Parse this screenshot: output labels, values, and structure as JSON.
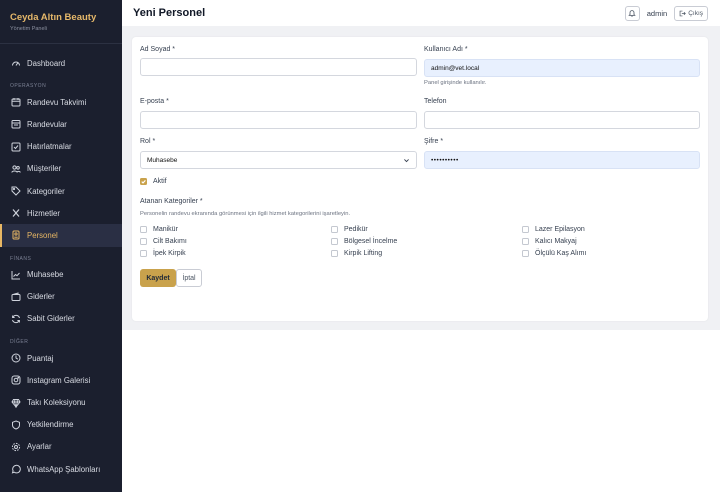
{
  "brand": {
    "title": "Ceyda Altın Beauty",
    "subtitle": "Yönetim Paneli"
  },
  "sidebar": {
    "sections": {
      "operasyon": "OPERASYON",
      "finans": "FİNANS",
      "diger": "DİĞER"
    },
    "items": [
      {
        "label": "Dashboard",
        "icon": "gauge-icon"
      },
      {
        "label": "Randevu Takvimi",
        "icon": "calendar-icon"
      },
      {
        "label": "Randevular",
        "icon": "calendar-list-icon"
      },
      {
        "label": "Hatırlatmalar",
        "icon": "checklist-icon"
      },
      {
        "label": "Müşteriler",
        "icon": "users-icon"
      },
      {
        "label": "Kategoriler",
        "icon": "tag-icon"
      },
      {
        "label": "Hizmetler",
        "icon": "scissors-icon"
      },
      {
        "label": "Personel",
        "icon": "id-card-icon",
        "active": true
      },
      {
        "label": "Muhasebe",
        "icon": "chart-line-icon"
      },
      {
        "label": "Giderler",
        "icon": "wallet-icon"
      },
      {
        "label": "Sabit Giderler",
        "icon": "repeat-icon"
      },
      {
        "label": "Puantaj",
        "icon": "clock-icon"
      },
      {
        "label": "Instagram Galerisi",
        "icon": "instagram-icon"
      },
      {
        "label": "Takı Koleksiyonu",
        "icon": "gem-icon"
      },
      {
        "label": "Yetkilendirme",
        "icon": "shield-icon"
      },
      {
        "label": "Ayarlar",
        "icon": "gear-icon"
      },
      {
        "label": "WhatsApp Şablonları",
        "icon": "whatsapp-icon"
      }
    ]
  },
  "header": {
    "title": "Yeni Personel",
    "user": "admin",
    "logout": "Çıkış"
  },
  "form": {
    "name_label": "Ad Soyad *",
    "name_value": "",
    "username_label": "Kullanıcı Adı *",
    "username_value": "admin@vet.local",
    "username_hint": "Panel girişinde kullanılır.",
    "email_label": "E-posta *",
    "email_value": "",
    "phone_label": "Telefon",
    "phone_value": "",
    "role_label": "Rol *",
    "role_value": "Muhasebe",
    "password_label": "Şifre *",
    "password_value": "••••••••••",
    "active_label": "Aktif",
    "active_checked": true,
    "categories_label": "Atanan Kategoriler *",
    "categories_hint": "Personelin randevu ekranında görünmesi için ilgili hizmet kategorilerini işaretleyin.",
    "categories": [
      "Manikür",
      "Pedikür",
      "Lazer Epilasyon",
      "Cilt Bakımı",
      "Bölgesel İncelme",
      "Kalıcı Makyaj",
      "İpek Kirpik",
      "Kirpik Lifting",
      "Ölçülü Kaş Alımı"
    ],
    "save_label": "Kaydet",
    "cancel_label": "İptal"
  },
  "colors": {
    "sidebar_bg": "#1b1f2e",
    "accent": "#c9a24c",
    "brand": "#e6b86a"
  }
}
